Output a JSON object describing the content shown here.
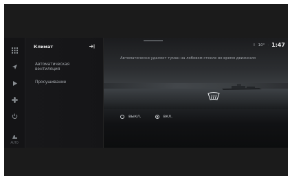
{
  "rail": {
    "items": [
      {
        "icon": "apps-icon"
      },
      {
        "icon": "navigation-icon"
      },
      {
        "icon": "media-icon"
      },
      {
        "icon": "fan-icon"
      },
      {
        "icon": "power-icon"
      }
    ],
    "bottom_label": "AUTO"
  },
  "menu": {
    "title": "Климат",
    "items": [
      {
        "label_line1": "Автоматическая",
        "label_line2": "вентиляция"
      },
      {
        "label_line1": "Просушивание",
        "label_line2": ""
      }
    ]
  },
  "content": {
    "notice": "Автоматически удаляет туман на лобовом стекле во время движения",
    "options": [
      {
        "label": "выкл.",
        "selected": false
      },
      {
        "label": "вкл.",
        "selected": true
      }
    ]
  },
  "status": {
    "signal": "⁝⁝",
    "temperature": "10°",
    "clock": "1:47"
  },
  "colors": {
    "background": "#101012",
    "text": "#c4c8cc",
    "accent": "#ececec"
  }
}
